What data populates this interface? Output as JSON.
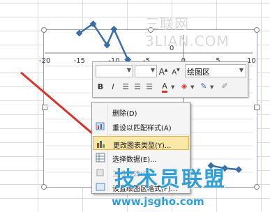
{
  "watermark": {
    "top": "三联网 3LIAN.COM",
    "bottom": "技术员联盟",
    "url": "www.jsgho.com"
  },
  "chart": {
    "axis_ticks": [
      "-20",
      "-15",
      "-10",
      "-5",
      "0",
      "5",
      "10"
    ],
    "y_tick_zero": "0",
    "series_color": "#3b6ea8"
  },
  "chart_data": {
    "type": "scatter",
    "x": [
      -15,
      -13,
      -11,
      -10,
      -8,
      4,
      6,
      8
    ],
    "y": [
      1.5,
      2.2,
      0.6,
      1.8,
      -0.5,
      -8.5,
      -8.7,
      -8.8
    ],
    "xlim": [
      -20,
      10
    ],
    "title": "",
    "xlabel": "",
    "ylabel": ""
  },
  "toolbar": {
    "font_value": "",
    "size_value": "",
    "grow_label": "A",
    "shrink_label": "A",
    "area_label": "绘图区",
    "bold_label": "B",
    "italic_label": "I",
    "font_color_label": "A"
  },
  "menu": {
    "items": [
      {
        "label": "删除(D)",
        "icon": "none"
      },
      {
        "label": "重设以匹配样式(A)",
        "icon": "reset-icon"
      },
      {
        "label": "更改图表类型(Y)...",
        "icon": "chart-type-icon"
      },
      {
        "label": "选择数据(E)...",
        "icon": "select-data-icon"
      },
      {
        "label": "三维旋转(R)...",
        "icon": "rotate-icon"
      },
      {
        "label": "设置绘图区格式(F)...",
        "icon": "format-icon"
      }
    ]
  },
  "arrow_color": "#d9342b"
}
